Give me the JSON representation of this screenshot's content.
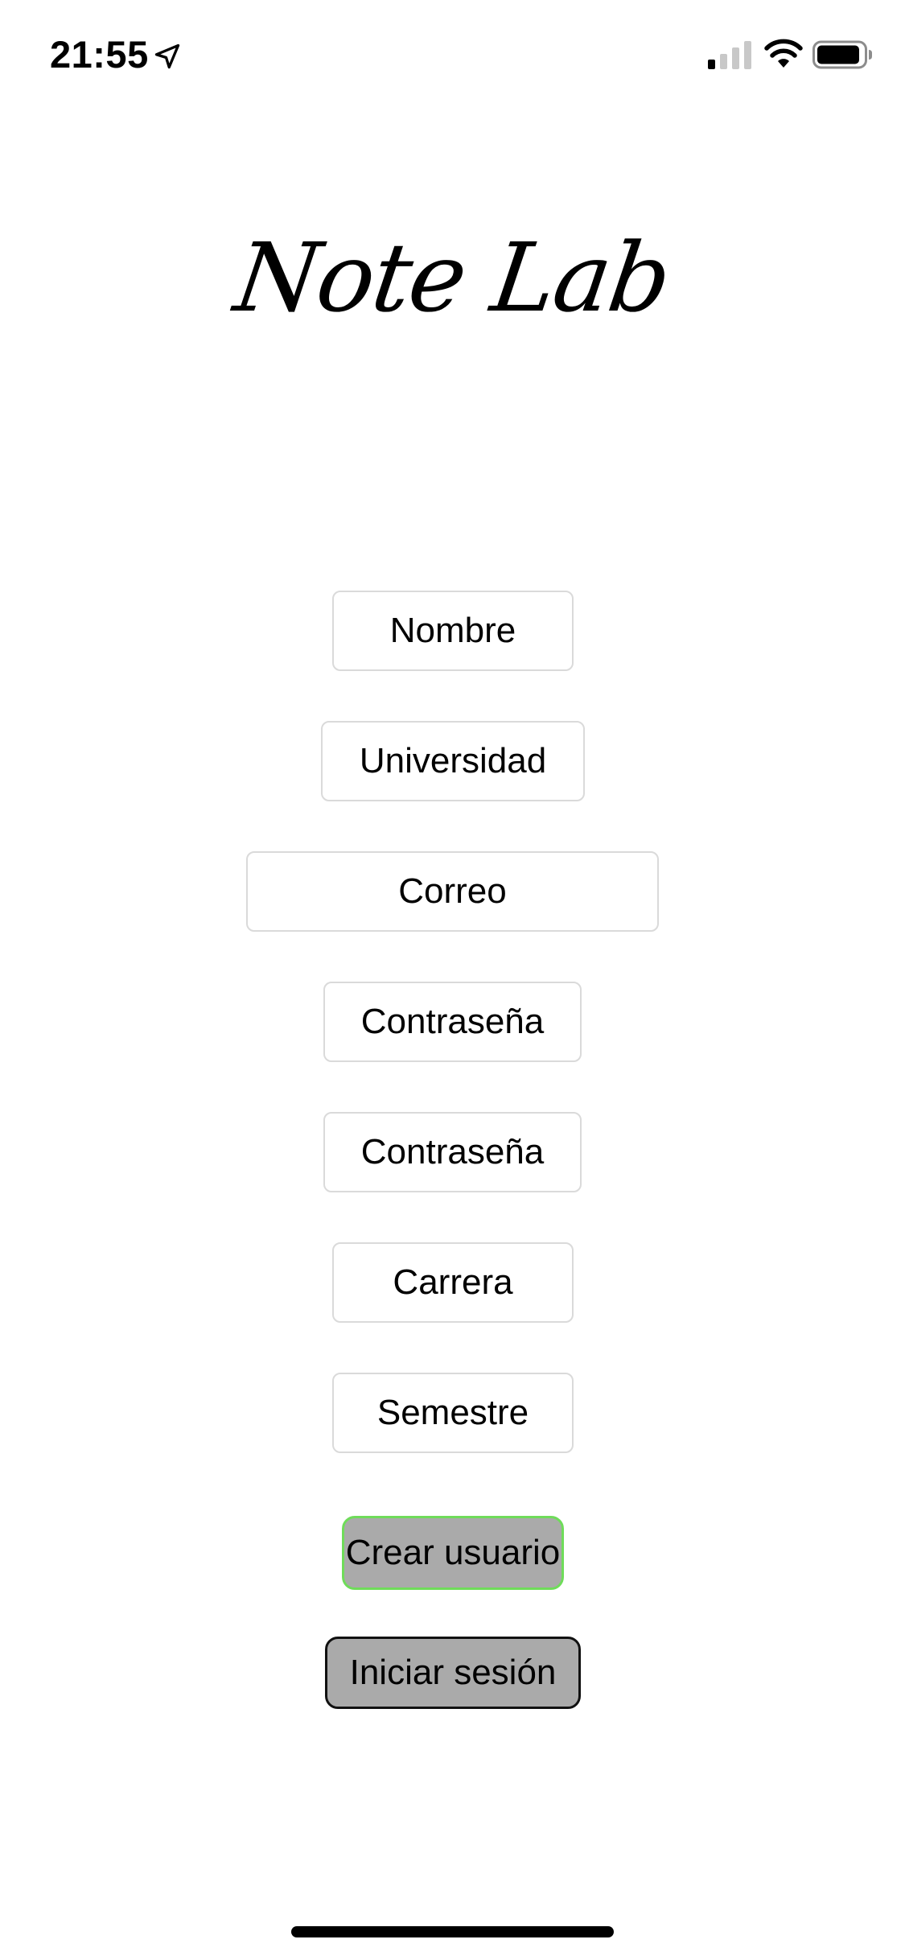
{
  "status_bar": {
    "time": "21:55",
    "icons": [
      "location-arrow-icon",
      "cellular-signal-icon",
      "wifi-icon",
      "battery-icon"
    ]
  },
  "logo": {
    "text": "Note Lab"
  },
  "form": {
    "fields": [
      {
        "placeholder": "Nombre"
      },
      {
        "placeholder": "Universidad"
      },
      {
        "placeholder": "Correo"
      },
      {
        "placeholder": "Contraseña"
      },
      {
        "placeholder": "Contraseña"
      },
      {
        "placeholder": "Carrera"
      },
      {
        "placeholder": "Semestre"
      }
    ]
  },
  "buttons": {
    "create_user": "Crear usuario",
    "sign_in": "Iniciar sesión"
  },
  "colors": {
    "background": "#ffffff",
    "button_fill": "#aaaaaa",
    "create_button_border": "#6fdc5a",
    "sign_in_button_border": "#111111",
    "field_border": "#dadada"
  }
}
